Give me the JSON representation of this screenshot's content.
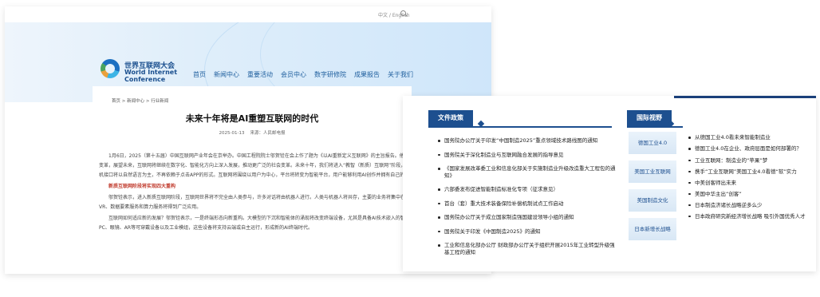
{
  "site": {
    "lang_switch": "中文 / English",
    "logo": {
      "cn": "世界互联网大会",
      "en_line1": "World Internet",
      "en_line2": "Conference"
    },
    "nav": [
      "首页",
      "新闻中心",
      "重要活动",
      "会员中心",
      "数字研修院",
      "成果报告",
      "关于我们"
    ],
    "breadcrumb": "首页  >  新闻中心  >  行业新闻",
    "article": {
      "title": "未来十年将是AI重塑互联网的时代",
      "date": "2025-01-13",
      "source": "来源：人民邮电报",
      "paragraphs": [
        "1月6日，2025（第十五届）中国互联网产业年会在京举办。中国工程院院士邬贺铨在会上作了题为《以AI重新定义互联网》的主旨报告。他表示，互联网在过去几十年经历了巨大变革，展望未来，互联网将继续在数字化、智能化方向上深入发展，推动更广泛的社会变革。未来十年，我们将进入“教智（新质）互联网”阶段，其核心特征是基础协议采用IPv6+，人机接口将以自然语言为主，不再依赖于点击APP的形式。互联网将围绕以用户为中心，平台将转变为智能平台，用户能够利用AI创作并拥有自己的作品。",
        "新质互联网阶段将实现四大重构",
        "邬贺铨表示，进入新质互联网阶段，互联网世界将不完全由人类参与，许多对话将由机器人进行。人类与机器人将共存，主要的业务将集中在基于大模型和智能体的应用上，AR、VR、数据要素服务和算力服务将得到广泛应用。",
        "互联网如何适应新的发展？邬贺铨表示，一是终端形态向新重构。大模型的下沉和智能体的涌现将改变终端设备，尤其是具备AI技术嵌入的智能化便携设备中，重新定义手机、PC、眼镜、AR等可穿戴设备以及工业模组，这些设备将支持云端或自主运行，形成新的AI终端时代。"
      ]
    }
  },
  "policy": {
    "section_title": "文件政策",
    "items": [
      "国务院办公厅关于印发“中国制造2025”重点领域技术路线图的通知",
      "国务院关于深化制造业与互联网融合发展的指导意见",
      "《国家发展改革委工业和信息化部关于实施制造业升级改造重大工程包的通知》",
      "六部委发布促进智能制造标准化专项（征求意见）",
      "首台（套）重大技术装备保险补偿机制试点工作启动",
      "国务院办公厅关于成立国家制造强国建设领导小组的通知",
      "国务院关于印发《中国制造2025》的通知",
      "工业和信息化部办公厅 财政部办公厅关于组织开展2015年工业转型升级强基工程的通知"
    ]
  },
  "international": {
    "section_title": "国际视野",
    "side_buttons": [
      "德国工业4.0",
      "美国工业互联网",
      "美国制造文化",
      "日本新增长战略"
    ],
    "items": [
      "从德国工业4.0看未来智能制造业",
      "德国工业4.0在企业、政府层面是如何部署的？",
      "工业互联网：制造业的“苹果”梦",
      "携手“工业互联网”美国工业4.0看德“软”实力",
      "中美创客师出未来",
      "美国中华主出“创客”",
      "日本制造济诸长战略逆多么少",
      "日本政府研究新经济增长战略 吸引外国优秀人才"
    ]
  }
}
